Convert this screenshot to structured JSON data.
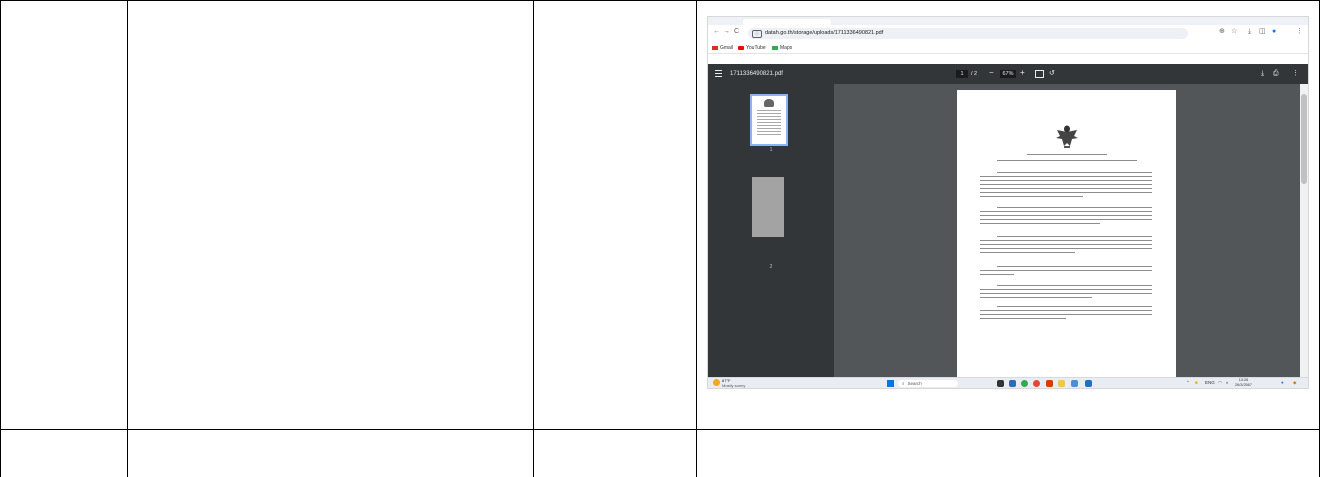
{
  "browser": {
    "nav": {
      "back": "←",
      "forward": "→",
      "reload": "C"
    },
    "url": "datah.go.th/storage/uploads/1711336490821.pdf",
    "right_icons": {
      "zoom": "⊕",
      "star": "☆",
      "download": "⤓",
      "split": "◫",
      "profile": "●",
      "menu": "⋮"
    },
    "bookmarks": [
      {
        "label": "Gmail",
        "color": "#d93025"
      },
      {
        "label": "YouTube",
        "color": "#ff0000"
      },
      {
        "label": "Maps",
        "color": "#34a853"
      }
    ]
  },
  "pdf_viewer": {
    "file_name": "1711336490821.pdf",
    "page_current": "1",
    "page_total": "/ 2",
    "zoom_minus": "−",
    "zoom_level": "67%",
    "zoom_plus": "+",
    "rotate_glyph": "↺",
    "download_glyph": "⤓",
    "print_glyph": "⎙",
    "more_glyph": "⋮",
    "thumbnails": [
      {
        "label": "1"
      },
      {
        "label": "2"
      }
    ]
  },
  "taskbar": {
    "weather_temp": "87°F",
    "weather_desc": "Mostly sunny",
    "search_placeholder": "Search",
    "search_icon": "magnifier-icon",
    "apps": [
      "file-explorer",
      "store",
      "chrome",
      "chrome-profile",
      "office",
      "file-manager",
      "paint",
      "outlook"
    ],
    "tray_lang": "ENG",
    "time": "13:26",
    "date": "26/3/2567"
  },
  "colors": {
    "pdf_toolbar": "#323639",
    "pdf_background": "#525659",
    "thumbnail_selected_border": "#8ab4f8",
    "taskbar": "#e9edf3"
  }
}
